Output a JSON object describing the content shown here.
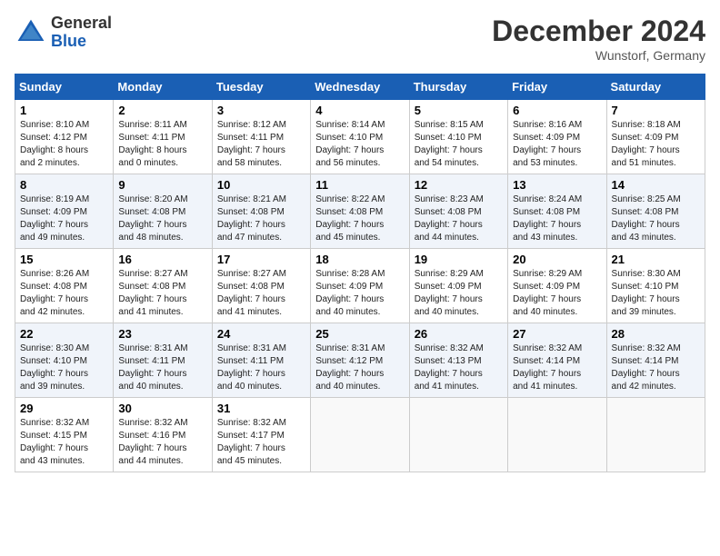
{
  "header": {
    "title": "December 2024",
    "location": "Wunstorf, Germany",
    "logo_general": "General",
    "logo_blue": "Blue"
  },
  "days_of_week": [
    "Sunday",
    "Monday",
    "Tuesday",
    "Wednesday",
    "Thursday",
    "Friday",
    "Saturday"
  ],
  "weeks": [
    [
      {
        "day": "1",
        "text": "Sunrise: 8:10 AM\nSunset: 4:12 PM\nDaylight: 8 hours\nand 2 minutes."
      },
      {
        "day": "2",
        "text": "Sunrise: 8:11 AM\nSunset: 4:11 PM\nDaylight: 8 hours\nand 0 minutes."
      },
      {
        "day": "3",
        "text": "Sunrise: 8:12 AM\nSunset: 4:11 PM\nDaylight: 7 hours\nand 58 minutes."
      },
      {
        "day": "4",
        "text": "Sunrise: 8:14 AM\nSunset: 4:10 PM\nDaylight: 7 hours\nand 56 minutes."
      },
      {
        "day": "5",
        "text": "Sunrise: 8:15 AM\nSunset: 4:10 PM\nDaylight: 7 hours\nand 54 minutes."
      },
      {
        "day": "6",
        "text": "Sunrise: 8:16 AM\nSunset: 4:09 PM\nDaylight: 7 hours\nand 53 minutes."
      },
      {
        "day": "7",
        "text": "Sunrise: 8:18 AM\nSunset: 4:09 PM\nDaylight: 7 hours\nand 51 minutes."
      }
    ],
    [
      {
        "day": "8",
        "text": "Sunrise: 8:19 AM\nSunset: 4:09 PM\nDaylight: 7 hours\nand 49 minutes."
      },
      {
        "day": "9",
        "text": "Sunrise: 8:20 AM\nSunset: 4:08 PM\nDaylight: 7 hours\nand 48 minutes."
      },
      {
        "day": "10",
        "text": "Sunrise: 8:21 AM\nSunset: 4:08 PM\nDaylight: 7 hours\nand 47 minutes."
      },
      {
        "day": "11",
        "text": "Sunrise: 8:22 AM\nSunset: 4:08 PM\nDaylight: 7 hours\nand 45 minutes."
      },
      {
        "day": "12",
        "text": "Sunrise: 8:23 AM\nSunset: 4:08 PM\nDaylight: 7 hours\nand 44 minutes."
      },
      {
        "day": "13",
        "text": "Sunrise: 8:24 AM\nSunset: 4:08 PM\nDaylight: 7 hours\nand 43 minutes."
      },
      {
        "day": "14",
        "text": "Sunrise: 8:25 AM\nSunset: 4:08 PM\nDaylight: 7 hours\nand 43 minutes."
      }
    ],
    [
      {
        "day": "15",
        "text": "Sunrise: 8:26 AM\nSunset: 4:08 PM\nDaylight: 7 hours\nand 42 minutes."
      },
      {
        "day": "16",
        "text": "Sunrise: 8:27 AM\nSunset: 4:08 PM\nDaylight: 7 hours\nand 41 minutes."
      },
      {
        "day": "17",
        "text": "Sunrise: 8:27 AM\nSunset: 4:08 PM\nDaylight: 7 hours\nand 41 minutes."
      },
      {
        "day": "18",
        "text": "Sunrise: 8:28 AM\nSunset: 4:09 PM\nDaylight: 7 hours\nand 40 minutes."
      },
      {
        "day": "19",
        "text": "Sunrise: 8:29 AM\nSunset: 4:09 PM\nDaylight: 7 hours\nand 40 minutes."
      },
      {
        "day": "20",
        "text": "Sunrise: 8:29 AM\nSunset: 4:09 PM\nDaylight: 7 hours\nand 40 minutes."
      },
      {
        "day": "21",
        "text": "Sunrise: 8:30 AM\nSunset: 4:10 PM\nDaylight: 7 hours\nand 39 minutes."
      }
    ],
    [
      {
        "day": "22",
        "text": "Sunrise: 8:30 AM\nSunset: 4:10 PM\nDaylight: 7 hours\nand 39 minutes."
      },
      {
        "day": "23",
        "text": "Sunrise: 8:31 AM\nSunset: 4:11 PM\nDaylight: 7 hours\nand 40 minutes."
      },
      {
        "day": "24",
        "text": "Sunrise: 8:31 AM\nSunset: 4:11 PM\nDaylight: 7 hours\nand 40 minutes."
      },
      {
        "day": "25",
        "text": "Sunrise: 8:31 AM\nSunset: 4:12 PM\nDaylight: 7 hours\nand 40 minutes."
      },
      {
        "day": "26",
        "text": "Sunrise: 8:32 AM\nSunset: 4:13 PM\nDaylight: 7 hours\nand 41 minutes."
      },
      {
        "day": "27",
        "text": "Sunrise: 8:32 AM\nSunset: 4:14 PM\nDaylight: 7 hours\nand 41 minutes."
      },
      {
        "day": "28",
        "text": "Sunrise: 8:32 AM\nSunset: 4:14 PM\nDaylight: 7 hours\nand 42 minutes."
      }
    ],
    [
      {
        "day": "29",
        "text": "Sunrise: 8:32 AM\nSunset: 4:15 PM\nDaylight: 7 hours\nand 43 minutes."
      },
      {
        "day": "30",
        "text": "Sunrise: 8:32 AM\nSunset: 4:16 PM\nDaylight: 7 hours\nand 44 minutes."
      },
      {
        "day": "31",
        "text": "Sunrise: 8:32 AM\nSunset: 4:17 PM\nDaylight: 7 hours\nand 45 minutes."
      },
      {
        "day": "",
        "text": ""
      },
      {
        "day": "",
        "text": ""
      },
      {
        "day": "",
        "text": ""
      },
      {
        "day": "",
        "text": ""
      }
    ]
  ]
}
